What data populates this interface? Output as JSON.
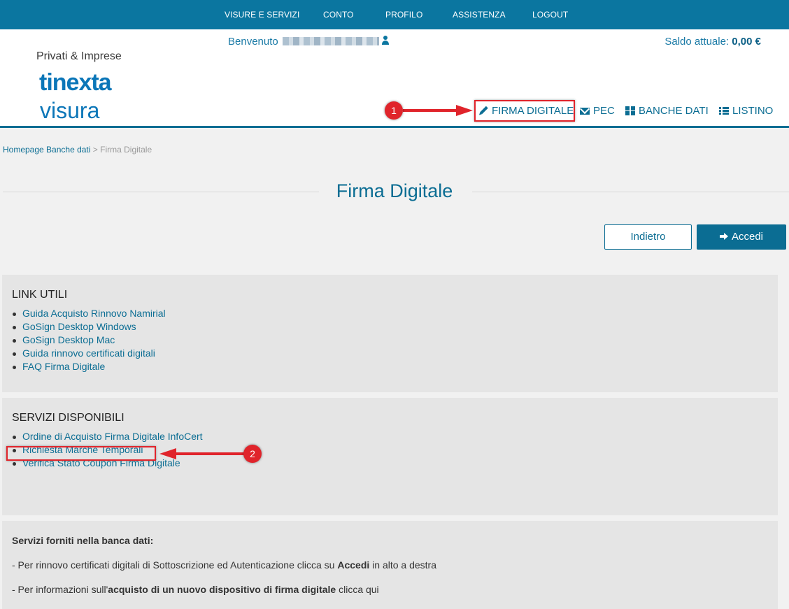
{
  "topnav": {
    "items": [
      "VISURE E SERVIZI",
      "CONTO",
      "PROFILO",
      "ASSISTENZA",
      "LOGOUT"
    ]
  },
  "header": {
    "brand_sub": "Privati & Imprese",
    "brand_logo": "tinexta",
    "brand_name": "visura",
    "welcome": "Benvenuto",
    "balance_label": "Saldo attuale:",
    "balance_value": "0,00 €"
  },
  "subnav": {
    "items": [
      {
        "label": "FIRMA DIGITALE",
        "icon": "pencil-icon"
      },
      {
        "label": "PEC",
        "icon": "envelope-icon"
      },
      {
        "label": "BANCHE DATI",
        "icon": "grid-icon"
      },
      {
        "label": "LISTINO",
        "icon": "list-icon"
      }
    ]
  },
  "breadcrumb": {
    "home": "Homepage Banche dati",
    "separator": ">",
    "current": "Firma Digitale"
  },
  "page_title": "Firma Digitale",
  "buttons": {
    "back": "Indietro",
    "login": "Accedi"
  },
  "link_utili": {
    "title": "LINK UTILI",
    "items": [
      "Guida Acquisto Rinnovo Namirial",
      "GoSign Desktop Windows",
      "GoSign Desktop Mac",
      "Guida rinnovo certificati digitali",
      "FAQ Firma Digitale"
    ]
  },
  "servizi": {
    "title": "SERVIZI DISPONIBILI",
    "items": [
      "Ordine di Acquisto Firma Digitale InfoCert",
      "Richiesta Marche Temporali",
      "Verifica Stato Coupon Firma Digitale"
    ]
  },
  "info": {
    "heading": "Servizi forniti nella banca dati:",
    "line1_pre": "- Per rinnovo certificati digitali di Sottoscrizione ed Autenticazione clicca su ",
    "line1_bold": "Accedi",
    "line1_post": " in alto a destra",
    "line2_pre": "- Per informazioni sull'",
    "line2_bold": "acquisto di un nuovo dispositivo di firma digitale",
    "line2_post": " clicca qui"
  },
  "annotations": {
    "marker1": "1",
    "marker2": "2"
  },
  "colors": {
    "primary": "#0b6d93",
    "topbar": "#0b76a0",
    "annotation": "#e0242b"
  }
}
